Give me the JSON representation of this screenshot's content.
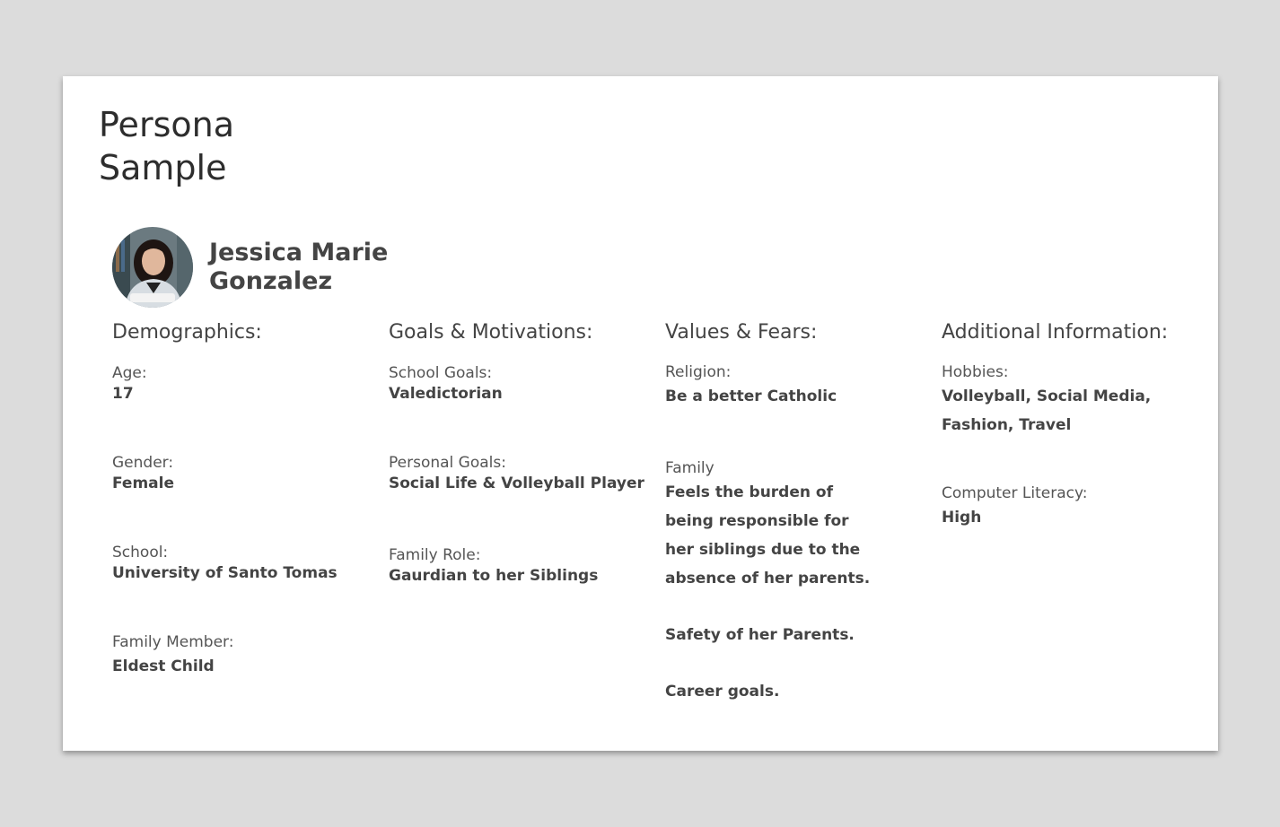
{
  "title": {
    "line1": "Persona",
    "line2": "Sample"
  },
  "persona": {
    "first_line": "Jessica Marie",
    "second_line": "Gonzalez"
  },
  "demographics": {
    "heading": "Demographics:",
    "age_label": "Age:",
    "age": "17",
    "gender_label": "Gender:",
    "gender": "Female",
    "school_label": "School:",
    "school": "University of Santo Tomas",
    "family_member_label": "Family Member:",
    "family_member": "Eldest Child"
  },
  "goals": {
    "heading": "Goals & Motivations:",
    "school_goals_label": "School Goals:",
    "school_goals": "Valedictorian",
    "personal_goals_label": "Personal Goals:",
    "personal_goals": "Social Life & Volleyball Player",
    "family_role_label": "Family Role:",
    "family_role": "Gaurdian to her Siblings"
  },
  "values": {
    "heading": "Values & Fears:",
    "religion_label": "Religion:",
    "religion": "Be a better Catholic",
    "family_label": "Family",
    "family_lines": [
      "Feels the burden of",
      "being responsible for",
      "her siblings due to the",
      "absence of her parents."
    ],
    "fear_1": "Safety of her Parents.",
    "fear_2": "Career goals."
  },
  "additional": {
    "heading": "Additional Information:",
    "hobbies_label": "Hobbies:",
    "hobbies_lines": [
      "Volleyball, Social Media,",
      "Fashion, Travel"
    ],
    "literacy_label": "Computer Literacy:",
    "literacy": "High"
  },
  "colors": {
    "background": "#dcdcdc",
    "card": "#ffffff",
    "text": "#444444"
  }
}
